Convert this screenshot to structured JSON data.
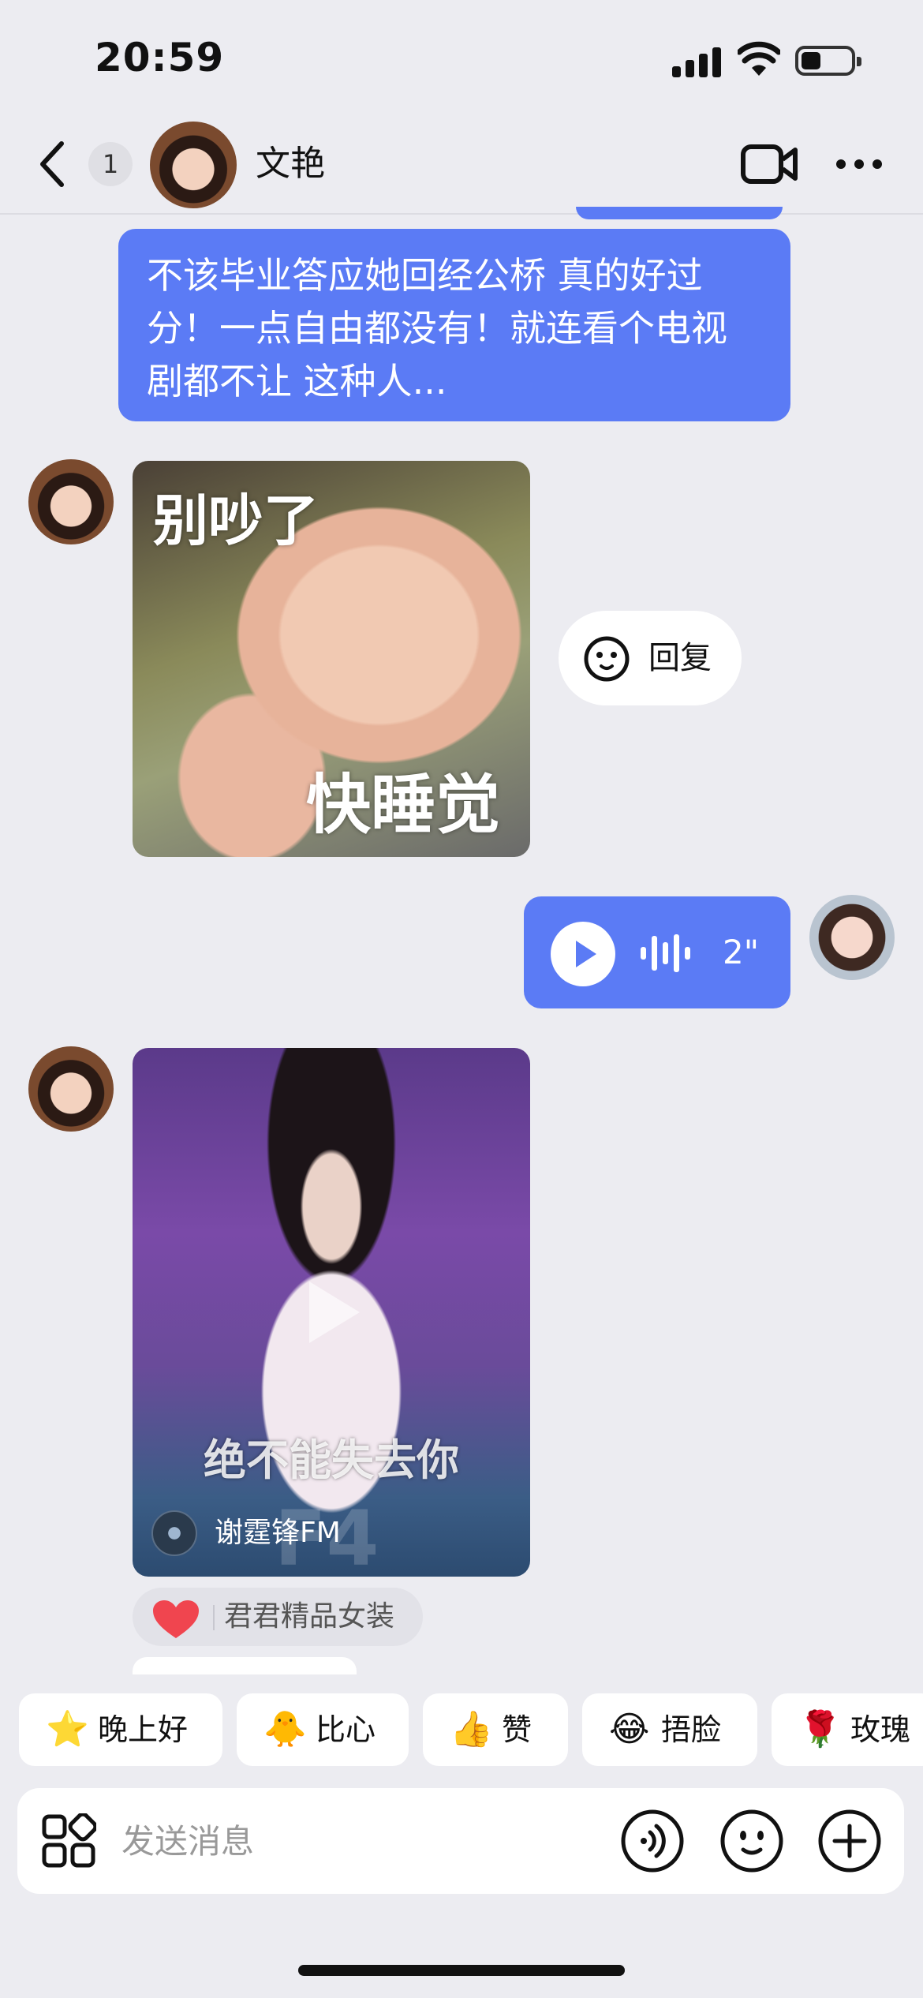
{
  "status_bar": {
    "time": "20:59",
    "icons": [
      "cellular-signal-icon",
      "wifi-icon",
      "battery-icon"
    ]
  },
  "header": {
    "back_icon": "chevron-left-icon",
    "unread_count": "1",
    "contact_name": "文艳",
    "video_call_icon": "video-camera-icon",
    "more_icon": "more-dots-icon"
  },
  "messages": {
    "text_message": "不该毕业答应她回经公桥 真的好过分！一点自由都没有！就连看个电视剧都不让 这种人...",
    "sticker": {
      "top_text": "别吵了",
      "bottom_text": "快睡觉"
    },
    "reply_chip": {
      "icon": "smiley-face-icon",
      "label": "回复"
    },
    "voice_message": {
      "duration": "2\"",
      "play_icon": "play-icon",
      "wave_icon": "sound-wave-icon"
    },
    "video_card": {
      "caption": "绝不能失去你",
      "watermark": "F4",
      "channel": "谢霆锋FM",
      "play_icon": "play-icon"
    },
    "reaction": {
      "icon": "heart-icon",
      "name": "君君精品女装"
    }
  },
  "quick_replies": [
    {
      "emoji": "⭐",
      "label": "晚上好"
    },
    {
      "emoji": "🐥",
      "label": "比心"
    },
    {
      "emoji": "👍",
      "label": "赞"
    },
    {
      "emoji": "😂",
      "label": "捂脸"
    },
    {
      "emoji": "🌹",
      "label": "玫瑰"
    }
  ],
  "input_bar": {
    "placeholder": "发送消息",
    "apps_icon": "apps-grid-icon",
    "voice_icon": "voice-input-icon",
    "emoji_icon": "smiley-face-icon",
    "plus_icon": "plus-circle-icon"
  },
  "colors": {
    "bubble_blue": "#5b7bf5",
    "background": "#ececf1",
    "heart_red": "#f0454f"
  }
}
